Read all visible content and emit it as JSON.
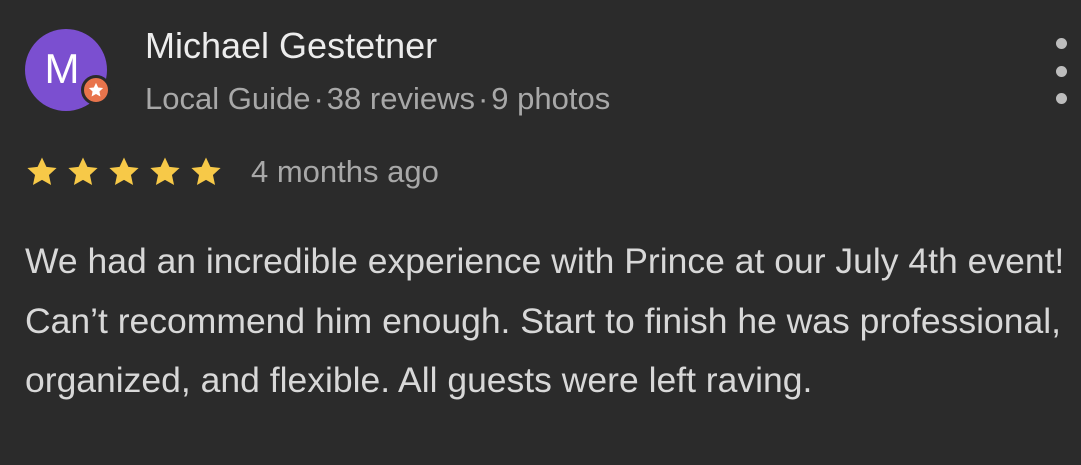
{
  "theme": {
    "background": "#2b2b2b",
    "avatar_color": "#7b4fd0",
    "badge_color": "#e8744c",
    "star_color": "#f7c948"
  },
  "review": {
    "author": {
      "avatar_letter": "M",
      "name": "Michael Gestetner",
      "guide_label": "Local Guide",
      "separator": "·",
      "reviews_count": "38 reviews",
      "photos_count": "9 photos"
    },
    "rating": 5,
    "date": "4 months ago",
    "text": "We had an incredible experience with Prince at our July 4th event! Can’t recommend him enough. Start to finish he was professional, organized, and flexible. All guests were left raving."
  },
  "icons": {
    "more": "more-vertical-icon",
    "star": "star-icon",
    "badge": "local-guide-badge-icon"
  }
}
